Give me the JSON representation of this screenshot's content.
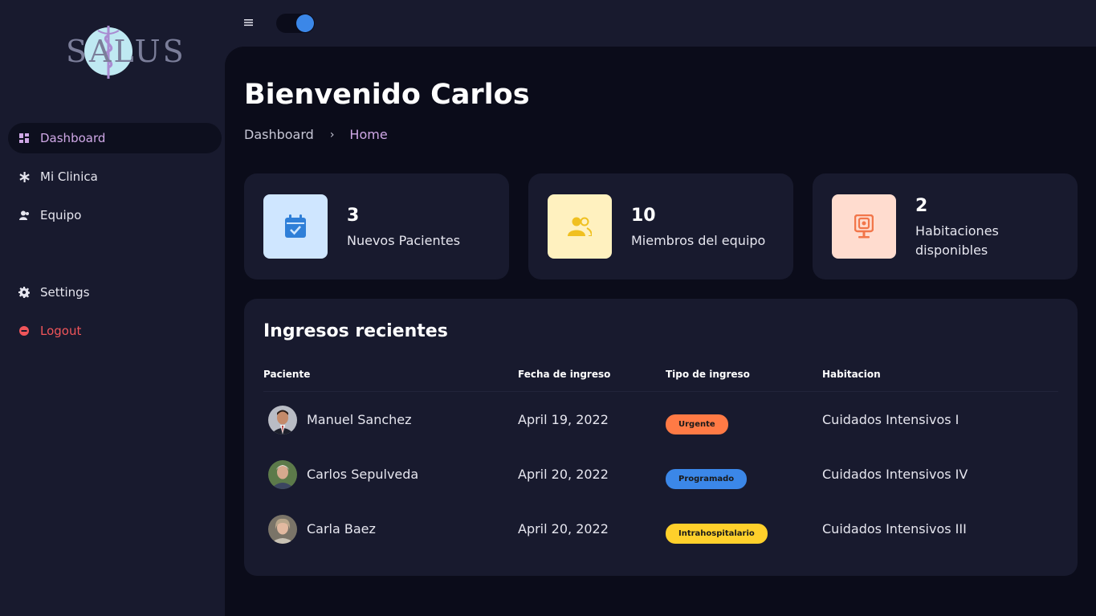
{
  "app": {
    "logo_text": "SALUS",
    "theme_toggle": "on",
    "colors": {
      "accent": "#cfa8e6",
      "toggle": "#3b87e8",
      "logout": "#f0555a",
      "urgente": "#ff7a45",
      "programado": "#3b87e8",
      "intrahospitalario": "#ffd02b"
    }
  },
  "sidebar": {
    "items": [
      {
        "label": "Dashboard",
        "icon": "dashboard-icon"
      },
      {
        "label": "Mi Clinica",
        "icon": "asterisk-icon"
      },
      {
        "label": "Equipo",
        "icon": "team-icon"
      },
      {
        "label": "Settings",
        "icon": "gear-icon"
      },
      {
        "label": "Logout",
        "icon": "logout-icon"
      }
    ]
  },
  "header": {
    "title": "Bienvenido Carlos",
    "breadcrumb": [
      "Dashboard",
      "Home"
    ]
  },
  "cards": [
    {
      "value": "3",
      "label": "Nuevos Pacientes",
      "icon": "calendar-check-icon"
    },
    {
      "value": "10",
      "label": "Miembros del equipo",
      "icon": "users-icon"
    },
    {
      "value": "2",
      "label": "Habitaciones disponibles",
      "icon": "room-icon"
    }
  ],
  "admissions": {
    "title": "Ingresos recientes",
    "columns": [
      "Paciente",
      "Fecha de ingreso",
      "Tipo de ingreso",
      "Habitacion"
    ],
    "rows": [
      {
        "patient": "Manuel Sanchez",
        "date": "April 19, 2022",
        "type": "Urgente",
        "room": "Cuidados Intensivos I"
      },
      {
        "patient": "Carlos Sepulveda",
        "date": "April 20, 2022",
        "type": "Programado",
        "room": "Cuidados Intensivos IV"
      },
      {
        "patient": "Carla Baez",
        "date": "April 20, 2022",
        "type": "Intrahospitalario",
        "room": "Cuidados Intensivos III"
      }
    ]
  }
}
